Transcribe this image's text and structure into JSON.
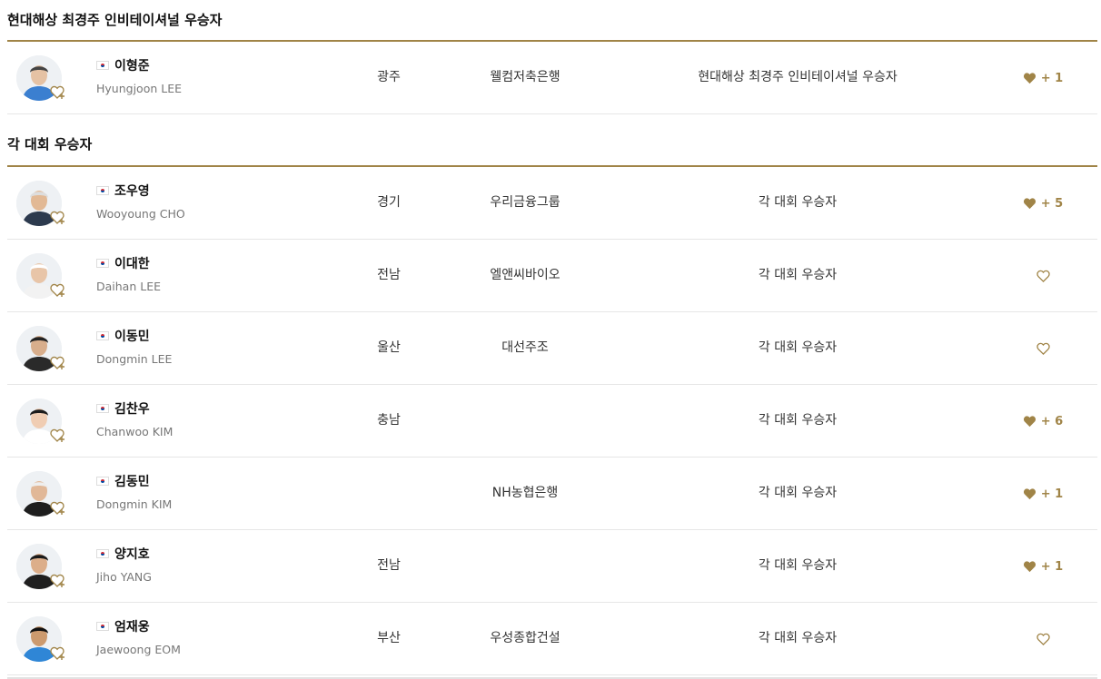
{
  "sections": [
    {
      "title": "현대해상 최경주 인비테이셔널 우승자",
      "players": [
        {
          "kname": "이형준",
          "ename": "Hyungjoon LEE",
          "region": "광주",
          "sponsor": "웰컴저축은행",
          "win": "현대해상 최경주 인비테이셔널 우승자",
          "liked": true,
          "like_count": "+ 1",
          "skin": "#e5c2a4",
          "shirt": "#3b7fd0",
          "hair": "#444444"
        }
      ]
    },
    {
      "title": "각 대회 우승자",
      "players": [
        {
          "kname": "조우영",
          "ename": "Wooyoung CHO",
          "region": "경기",
          "sponsor": "우리금융그룹",
          "win": "각 대회 우승자",
          "liked": true,
          "like_count": "+ 5",
          "skin": "#e2b995",
          "shirt": "#2c3a4e",
          "hair": "#dddddd"
        },
        {
          "kname": "이대한",
          "ename": "Daihan LEE",
          "region": "전남",
          "sponsor": "엘앤씨바이오",
          "win": "각 대회 우승자",
          "liked": false,
          "like_count": "",
          "skin": "#e8c5a8",
          "shirt": "#f2f2f2",
          "hair": "#ffffff"
        },
        {
          "kname": "이동민",
          "ename": "Dongmin LEE",
          "region": "울산",
          "sponsor": "대선주조",
          "win": "각 대회 우승자",
          "liked": false,
          "like_count": "",
          "skin": "#d8ae8c",
          "shirt": "#2a2a2a",
          "hair": "#222222"
        },
        {
          "kname": "김찬우",
          "ename": "Chanwoo KIM",
          "region": "충남",
          "sponsor": "",
          "win": "각 대회 우승자",
          "liked": true,
          "like_count": "+ 6",
          "skin": "#f0cdb3",
          "shirt": "#ffffff",
          "hair": "#1c1c1c"
        },
        {
          "kname": "김동민",
          "ename": "Dongmin KIM",
          "region": "",
          "sponsor": "NH농협은행",
          "win": "각 대회 우승자",
          "liked": true,
          "like_count": "+ 1",
          "skin": "#e1b898",
          "shirt": "#1e1e1e",
          "hair": "#eeeeee"
        },
        {
          "kname": "양지호",
          "ename": "Jiho YANG",
          "region": "전남",
          "sponsor": "",
          "win": "각 대회 우승자",
          "liked": true,
          "like_count": "+ 1",
          "skin": "#dcae8a",
          "shirt": "#1f1f1f",
          "hair": "#1a1a1a"
        },
        {
          "kname": "엄재웅",
          "ename": "Jaewoong EOM",
          "region": "부산",
          "sponsor": "우성종합건설",
          "win": "각 대회 우승자",
          "liked": false,
          "like_count": "",
          "skin": "#cc9a6e",
          "shirt": "#2f86d6",
          "hair": "#111111"
        }
      ]
    }
  ],
  "colors": {
    "accent": "#a08447",
    "divider": "#e6e6e6"
  },
  "icons": {
    "like_filled": "heart-filled-icon",
    "like_empty": "heart-outline-icon",
    "favorite_add": "heart-plus-icon",
    "flag": "korea-flag-icon"
  }
}
